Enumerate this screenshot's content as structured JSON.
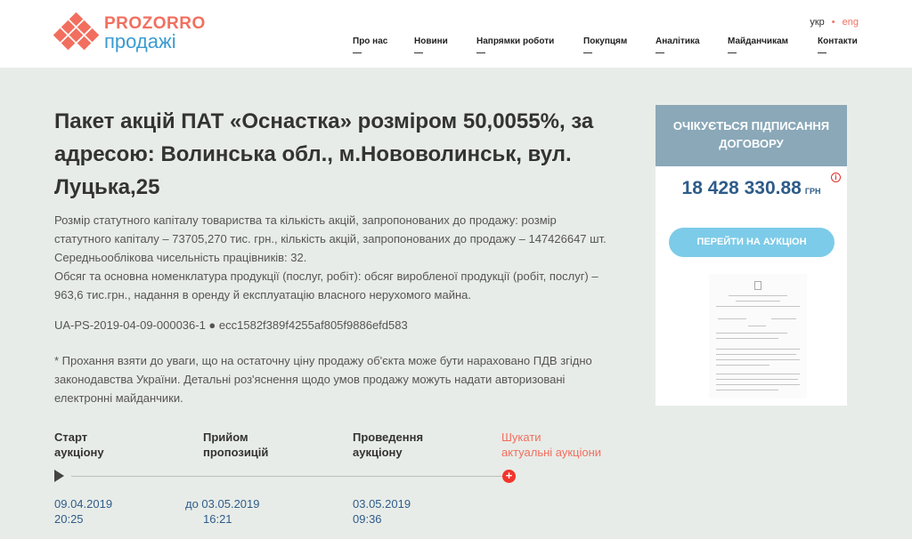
{
  "header": {
    "logo": {
      "line1": "PROZORRO",
      "line2": "продажі"
    },
    "lang": {
      "ukr": "укр",
      "separator": "•",
      "eng": "eng"
    },
    "nav": [
      "Про нас",
      "Новини",
      "Напрямки роботи",
      "Покупцям",
      "Аналітика",
      "Майданчикам",
      "Контакти"
    ]
  },
  "lot": {
    "title": "Пакет акцій ПАТ «Оснастка» розміром 50,0055%, за адресою: Волинська обл., м.Нововолинськ, вул. Луцька,25",
    "description_lines": [
      "Розмір статутного капіталу товариства та кількість акцій, запропонованих до продажу: розмір",
      "статутного капіталу – 73705,270 тис. грн., кількість акцій, запропонованих до продажу – 147426647 шт.",
      "Середньооблікова чисельність працівників: 32.",
      "Обсяг та основна номенклатура продукції (послуг, робіт): обсяг виробленої продукції (робіт, послуг) –",
      "963,6 тис.грн., надання в оренду й експлуатацію власного нерухомого майна."
    ],
    "identifier": "UA-PS-2019-04-09-000036-1 ● ecc1582f389f4255af805f9886efd583",
    "note": "* Прохання взяти до уваги, що на остаточну ціну продажу об'єкта може бути нараховано ПДВ згідно законодавства України. Детальні роз'яснення щодо умов продажу можуть надати авторизовані електронні майданчики."
  },
  "timeline": {
    "steps": [
      {
        "label_line1": "Старт",
        "label_line2": "аукціону",
        "date": "09.04.2019",
        "time": "20:25"
      },
      {
        "label_line1": "Прийом",
        "label_line2": "пропозицій",
        "date": "до 03.05.2019",
        "time": "16:21"
      },
      {
        "label_line1": "Проведення",
        "label_line2": "аукціону",
        "date": "03.05.2019",
        "time": "09:36"
      }
    ],
    "search": {
      "label_line1": "Шукати",
      "label_line2": "актуальні аукціони",
      "icon": "+"
    }
  },
  "card": {
    "status": "ОЧІКУЄТЬСЯ ПІДПИСАННЯ ДОГОВОРУ",
    "price": "18 428 330.88",
    "currency": "ГРН",
    "info_icon": "i",
    "cta": "ПЕРЕЙТИ НА АУКЦІОН"
  },
  "colors": {
    "accent": "#f26f5f",
    "brand_blue": "#3a9bd0",
    "status_bg": "#8aa8b8",
    "price": "#2e5c8a",
    "cta_bg": "#7ccbe8",
    "page_bg": "#e8ece8"
  }
}
